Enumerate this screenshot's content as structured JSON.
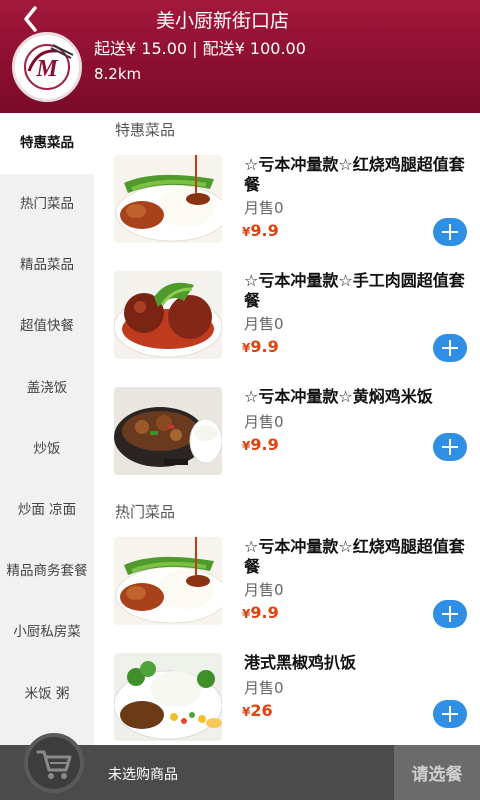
{
  "header": {
    "store_name": "美小厨新街口店",
    "fees": "起送¥ 15.00 | 配送¥ 100.00",
    "distance": "8.2km",
    "back_icon": "chevron-left-icon",
    "logo_letter": "M"
  },
  "sidebar": {
    "categories": [
      {
        "label": "特惠菜品",
        "active": true
      },
      {
        "label": "热门菜品"
      },
      {
        "label": "精品菜品"
      },
      {
        "label": "超值快餐"
      },
      {
        "label": "盖浇饭"
      },
      {
        "label": "炒饭"
      },
      {
        "label": "炒面 凉面"
      },
      {
        "label": "精品商务套餐"
      },
      {
        "label": "小厨私房菜"
      },
      {
        "label": "米饭 粥"
      }
    ]
  },
  "sections": [
    {
      "title": "特惠菜品",
      "items": [
        {
          "name": "☆亏本冲量款☆红烧鸡腿超值套餐",
          "sold": "月售0",
          "currency": "¥",
          "price": "9.9"
        },
        {
          "name": "☆亏本冲量款☆手工肉圆超值套餐",
          "sold": "月售0",
          "currency": "¥",
          "price": "9.9"
        },
        {
          "name": "☆亏本冲量款☆黄焖鸡米饭",
          "sold": "月售0",
          "currency": "¥",
          "price": "9.9"
        }
      ]
    },
    {
      "title": "热门菜品",
      "items": [
        {
          "name": "☆亏本冲量款☆红烧鸡腿超值套餐",
          "sold": "月售0",
          "currency": "¥",
          "price": "9.9"
        },
        {
          "name": "港式黑椒鸡扒饭",
          "sold": "月售0",
          "currency": "¥",
          "price": "26"
        }
      ]
    }
  ],
  "footer": {
    "cart_icon": "shopping-cart-icon",
    "message": "未选购商品",
    "checkout_label": "请选餐"
  },
  "colors": {
    "header": "#8c0f31",
    "price": "#e4400c",
    "add_button": "#2f8fe4",
    "footer": "#4b4b4b"
  }
}
